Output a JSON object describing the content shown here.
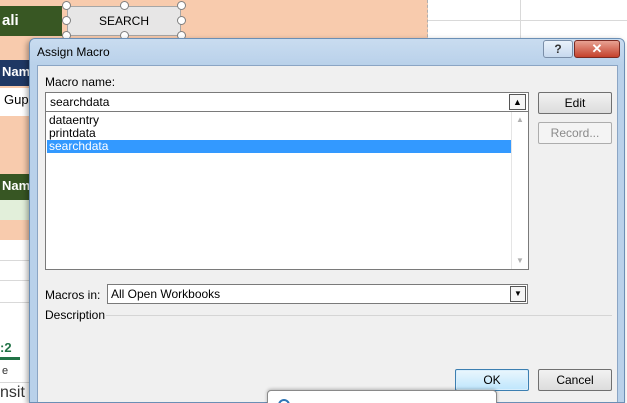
{
  "spreadsheet": {
    "cell_ali": "ali",
    "cell_name1": "Nam",
    "cell_gup": "Gup",
    "cell_name2": "Nam",
    "sheet_tab": ":2",
    "row_e": "e",
    "row_nsit": "nsit",
    "search_button_label": "SEARCH"
  },
  "dialog": {
    "title": "Assign Macro",
    "help_label": "?",
    "close_label": "✕",
    "macro_name_label": "Macro name:",
    "macro_name_value": "searchdata",
    "up_arrow_icon": "upload-arrow-icon",
    "macros": [
      {
        "label": "dataentry",
        "selected": false
      },
      {
        "label": "printdata",
        "selected": false
      },
      {
        "label": "searchdata",
        "selected": true
      }
    ],
    "edit_label": "Edit",
    "record_label": "Record...",
    "macros_in_label": "Macros in:",
    "macros_in_value": "All Open Workbooks",
    "description_label": "Description",
    "ok_label": "OK",
    "cancel_label": "Cancel"
  },
  "colors": {
    "selection": "#3399ff",
    "sheet_background": "#f8cbad",
    "header_green": "#385723",
    "dialog_frame": "#b9d1ea",
    "close_red": "#c4412b"
  }
}
